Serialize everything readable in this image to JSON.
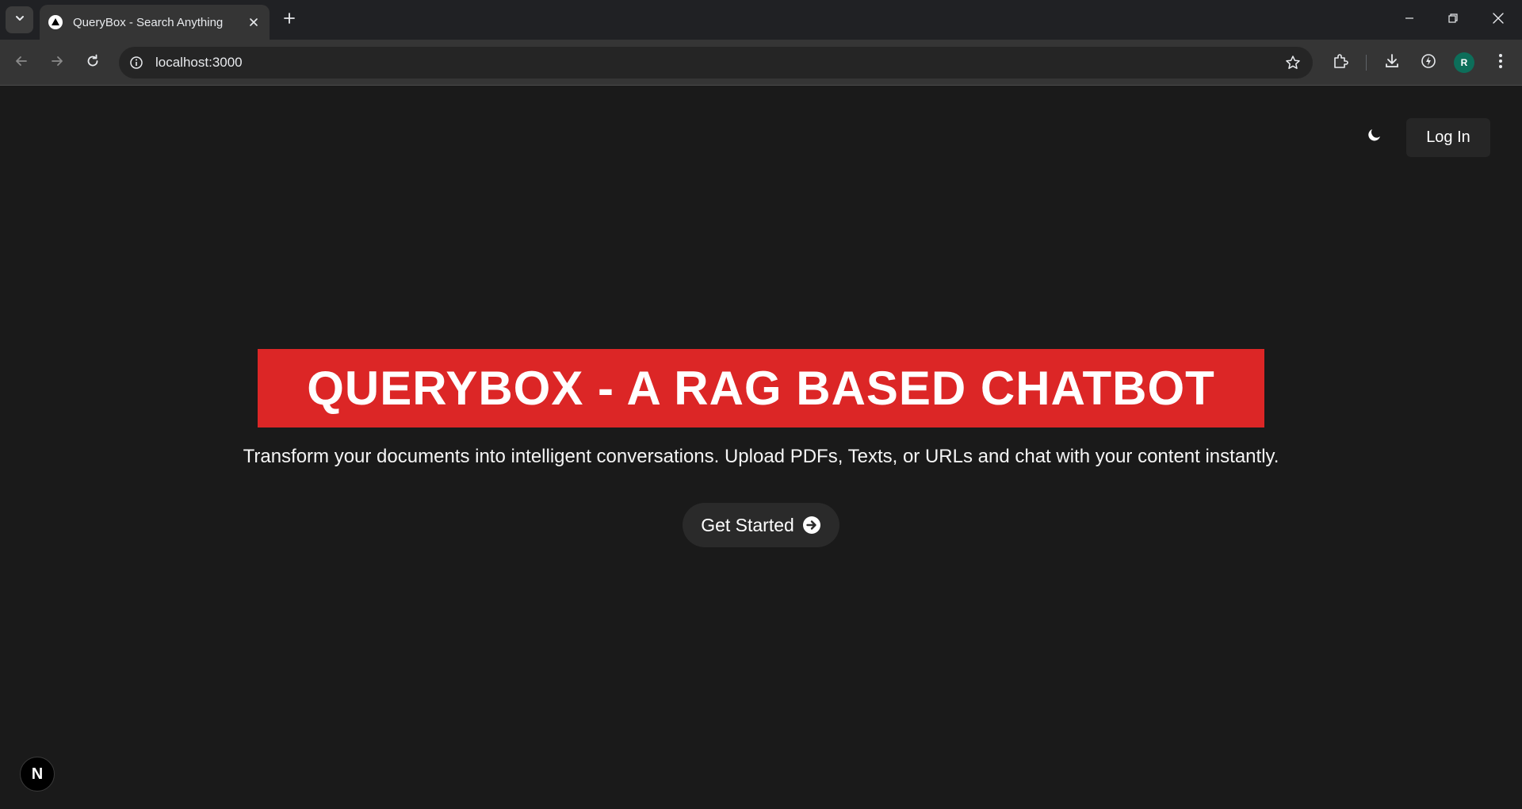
{
  "browser": {
    "tab": {
      "title": "QueryBox - Search Anything",
      "favicon": "triangle-logo-icon"
    },
    "address_bar": {
      "url": "localhost:3000"
    },
    "profile_initial": "R",
    "icons": {
      "tab_search": "chevron-down-icon",
      "new_tab": "plus-icon",
      "back": "arrow-left-icon",
      "forward": "arrow-right-icon",
      "reload": "reload-icon",
      "site_info": "info-icon",
      "bookmark": "star-icon",
      "extensions": "puzzle-icon",
      "downloads": "download-icon",
      "performance": "performance-icon",
      "menu": "kebab-menu-icon",
      "minimize": "minimize-icon",
      "restore": "restore-icon",
      "close": "close-icon"
    }
  },
  "page": {
    "header": {
      "theme_toggle_icon": "moon-icon",
      "login_label": "Log In"
    },
    "hero": {
      "title": "QUERYBOX - A RAG BASED CHATBOT",
      "subtitle": "Transform your documents into intelligent conversations. Upload PDFs, Texts, or URLs and chat with your content instantly.",
      "cta_label": "Get Started",
      "cta_icon": "arrow-circle-right-icon"
    },
    "dev_badge": "N"
  },
  "colors": {
    "page_background": "#1a1a1a",
    "title_background": "#dc2626",
    "title_text": "#ffffff",
    "button_background": "#262626",
    "profile_avatar": "#0d6e5a"
  }
}
